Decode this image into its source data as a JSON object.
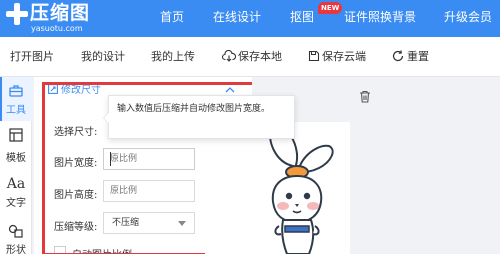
{
  "app": {
    "logo_title": "压缩图",
    "logo_domain": "yasuotu.com"
  },
  "nav": {
    "items": [
      {
        "label": "首页"
      },
      {
        "label": "在线设计"
      },
      {
        "label": "抠图"
      },
      {
        "label": "证件照换背景"
      },
      {
        "label": "升级会员"
      }
    ],
    "new_badge": "NEW"
  },
  "toolbar": {
    "open_image": "打开图片",
    "my_designs": "我的设计",
    "my_uploads": "我的上传",
    "save_local": "保存本地",
    "save_cloud": "保存云端",
    "reset": "重置"
  },
  "rail": {
    "items": [
      {
        "label": "工具",
        "icon": "toolbox-icon",
        "active": true
      },
      {
        "label": "模板",
        "icon": "template-icon"
      },
      {
        "label": "文字",
        "icon": "text-icon",
        "glyph": "Aa"
      },
      {
        "label": "形状",
        "icon": "shape-icon"
      }
    ]
  },
  "panel": {
    "section_title": "修改尺寸",
    "select_size_label": "选择尺寸:",
    "width_label": "图片宽度:",
    "width_placeholder": "原比例",
    "height_label": "图片高度:",
    "height_placeholder": "原比例",
    "compress_level_label": "压缩等级:",
    "compress_level_value": "不压缩",
    "checkbox_label": "自动图片比例"
  },
  "tooltip": {
    "text": "输入数值后压缩并自动修改图片宽度。"
  },
  "colors": {
    "brand": "#3a8cf3",
    "highlight": "#e4393c",
    "badge": "#e8373e"
  }
}
